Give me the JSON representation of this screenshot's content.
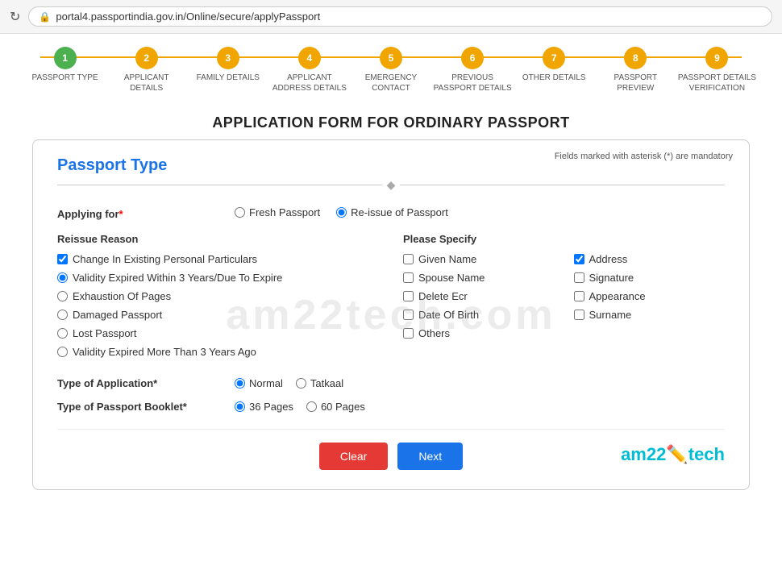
{
  "browser": {
    "url": "portal4.passportindia.gov.in/Online/secure/applyPassport",
    "refresh_icon": "↻",
    "lock_icon": "🔒"
  },
  "steps": [
    {
      "number": "1",
      "label": "PASSPORT TYPE",
      "state": "active"
    },
    {
      "number": "2",
      "label": "APPLICANT\nDETAILS",
      "state": "pending"
    },
    {
      "number": "3",
      "label": "FAMILY DETAILS",
      "state": "pending"
    },
    {
      "number": "4",
      "label": "APPLICANT\nADDRESS DETAILS",
      "state": "pending"
    },
    {
      "number": "5",
      "label": "EMERGENCY\nCONTACT",
      "state": "pending"
    },
    {
      "number": "6",
      "label": "PREVIOUS\nPASSPORT DETAILS",
      "state": "pending"
    },
    {
      "number": "7",
      "label": "OTHER DETAILS",
      "state": "pending"
    },
    {
      "number": "8",
      "label": "PASSPORT\nPREVIEW",
      "state": "pending"
    },
    {
      "number": "9",
      "label": "PASSPORT DETAILS\nVERIFICATION",
      "state": "pending"
    }
  ],
  "page_title": "APPLICATION FORM FOR ORDINARY PASSPORT",
  "mandatory_note": "Fields marked with asterisk (*) are mandatory",
  "section_title": "Passport Type",
  "applying_for_label": "Applying for*",
  "applying_for_options": [
    {
      "value": "fresh",
      "label": "Fresh Passport",
      "checked": false
    },
    {
      "value": "reissue",
      "label": "Re-issue of Passport",
      "checked": true
    }
  ],
  "reissue_reason_label": "Reissue Reason",
  "reissue_reasons": [
    {
      "id": "r1",
      "label": "Change In Existing Personal Particulars",
      "type": "checkbox",
      "checked": true
    },
    {
      "id": "r2",
      "label": "Validity Expired Within 3 Years/Due To Expire",
      "type": "radio",
      "checked": true
    },
    {
      "id": "r3",
      "label": "Exhaustion Of Pages",
      "type": "radio",
      "checked": false
    },
    {
      "id": "r4",
      "label": "Damaged Passport",
      "type": "radio",
      "checked": false
    },
    {
      "id": "r5",
      "label": "Lost Passport",
      "type": "radio",
      "checked": false
    },
    {
      "id": "r6",
      "label": "Validity Expired More Than 3 Years Ago",
      "type": "radio",
      "checked": false
    }
  ],
  "please_specify_label": "Please Specify",
  "specify_col1": [
    {
      "id": "s1",
      "label": "Given Name",
      "checked": false
    },
    {
      "id": "s2",
      "label": "Spouse Name",
      "checked": false
    },
    {
      "id": "s3",
      "label": "Delete Ecr",
      "checked": false
    },
    {
      "id": "s4",
      "label": "Date Of Birth",
      "checked": false
    },
    {
      "id": "s5",
      "label": "Others",
      "checked": false
    }
  ],
  "specify_col2": [
    {
      "id": "s6",
      "label": "Address",
      "checked": true
    },
    {
      "id": "s7",
      "label": "Signature",
      "checked": false
    },
    {
      "id": "s8",
      "label": "Appearance",
      "checked": false
    },
    {
      "id": "s9",
      "label": "Surname",
      "checked": false
    }
  ],
  "type_of_application_label": "Type of Application*",
  "application_type_options": [
    {
      "value": "normal",
      "label": "Normal",
      "checked": true
    },
    {
      "value": "tatkaal",
      "label": "Tatkaal",
      "checked": false
    }
  ],
  "type_of_booklet_label": "Type of Passport Booklet*",
  "booklet_options": [
    {
      "value": "36",
      "label": "36 Pages",
      "checked": true
    },
    {
      "value": "60",
      "label": "60 Pages",
      "checked": false
    }
  ],
  "buttons": {
    "clear": "Clear",
    "next": "Next"
  },
  "watermark": "am22tech.com",
  "branding": "am22"
}
